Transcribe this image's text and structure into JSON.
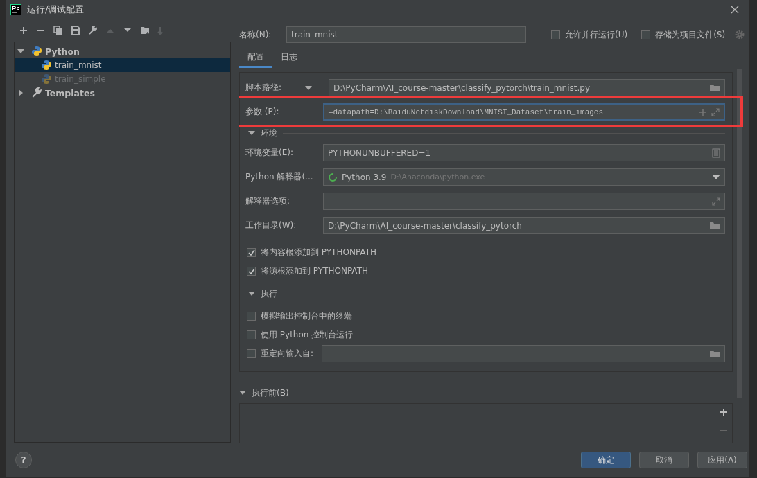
{
  "window": {
    "title": "运行/调试配置"
  },
  "toolbar": [
    {
      "kind": "add",
      "disabled": false
    },
    {
      "kind": "remove",
      "disabled": false
    },
    {
      "kind": "copy",
      "disabled": false
    },
    {
      "kind": "save",
      "disabled": false
    },
    {
      "kind": "wrench",
      "disabled": false
    },
    {
      "kind": "up",
      "disabled": true
    },
    {
      "kind": "down",
      "disabled": false
    },
    {
      "kind": "folder",
      "disabled": false
    },
    {
      "kind": "sort",
      "disabled": true
    }
  ],
  "tree": [
    {
      "label": "Python",
      "kind": "python",
      "expanded": true,
      "children": [
        {
          "label": "train_mnist",
          "kind": "python",
          "selected": true,
          "disabled": false
        },
        {
          "label": "train_simple",
          "kind": "python",
          "selected": false,
          "disabled": true
        }
      ]
    },
    {
      "label": "Templates",
      "kind": "wrench",
      "expanded": false
    }
  ],
  "name_field": {
    "label": "名称(N):",
    "value": "train_mnist"
  },
  "options": [
    {
      "label": "允许并行运行(U)",
      "checked": false
    },
    {
      "label": "存储为项目文件(S)",
      "checked": false
    }
  ],
  "tabs": [
    {
      "label": "配置",
      "selected": true
    },
    {
      "label": "日志",
      "selected": false
    }
  ],
  "fields": [
    {
      "kind": "script",
      "label": "脚本路径:",
      "value": "D:\\PyCharm\\AI_course-master\\classify_pytorch\\train_mnist.py"
    },
    {
      "kind": "params",
      "label": "参数 (P):",
      "value": "—datapath=D:\\BaiduNetdiskDownload\\MNIST_Dataset\\train_images",
      "highlighted": true
    }
  ],
  "sections": [
    {
      "title": "环境",
      "expanded": true,
      "fields": [
        {
          "kind": "env",
          "label": "环境变量(E):",
          "value": "PYTHONUNBUFFERED=1"
        },
        {
          "kind": "interpreter",
          "label": "Python 解释器(...",
          "value": "Python 3.9",
          "detail": "D:\\Anaconda\\python.exe"
        },
        {
          "kind": "options",
          "label": "解释器选项:"
        },
        {
          "kind": "dir",
          "label": "工作目录(W):",
          "value": "D:\\PyCharm\\AI_course-master\\classify_pytorch"
        }
      ],
      "checks": [
        {
          "kind": "plain",
          "label": "将内容根添加到 PYTHONPATH",
          "checked": true
        },
        {
          "kind": "plain",
          "label": "将源根添加到 PYTHONPATH",
          "checked": true
        }
      ]
    },
    {
      "title": "执行",
      "expanded": true,
      "checks": [
        {
          "kind": "plain",
          "label": "模拟输出控制台中的终端",
          "checked": false
        },
        {
          "kind": "plain",
          "label": "使用 Python 控制台运行",
          "checked": false
        },
        {
          "kind": "field",
          "label": "重定向输入自:",
          "checked": false
        }
      ]
    }
  ],
  "before_launch": {
    "title": "执行前(B)",
    "expanded": true
  },
  "help": "?",
  "buttons": [
    {
      "label": "确定",
      "kind": "primary"
    },
    {
      "label": "取消",
      "kind": "normal"
    },
    {
      "label": "应用(A)",
      "kind": "normal"
    }
  ]
}
